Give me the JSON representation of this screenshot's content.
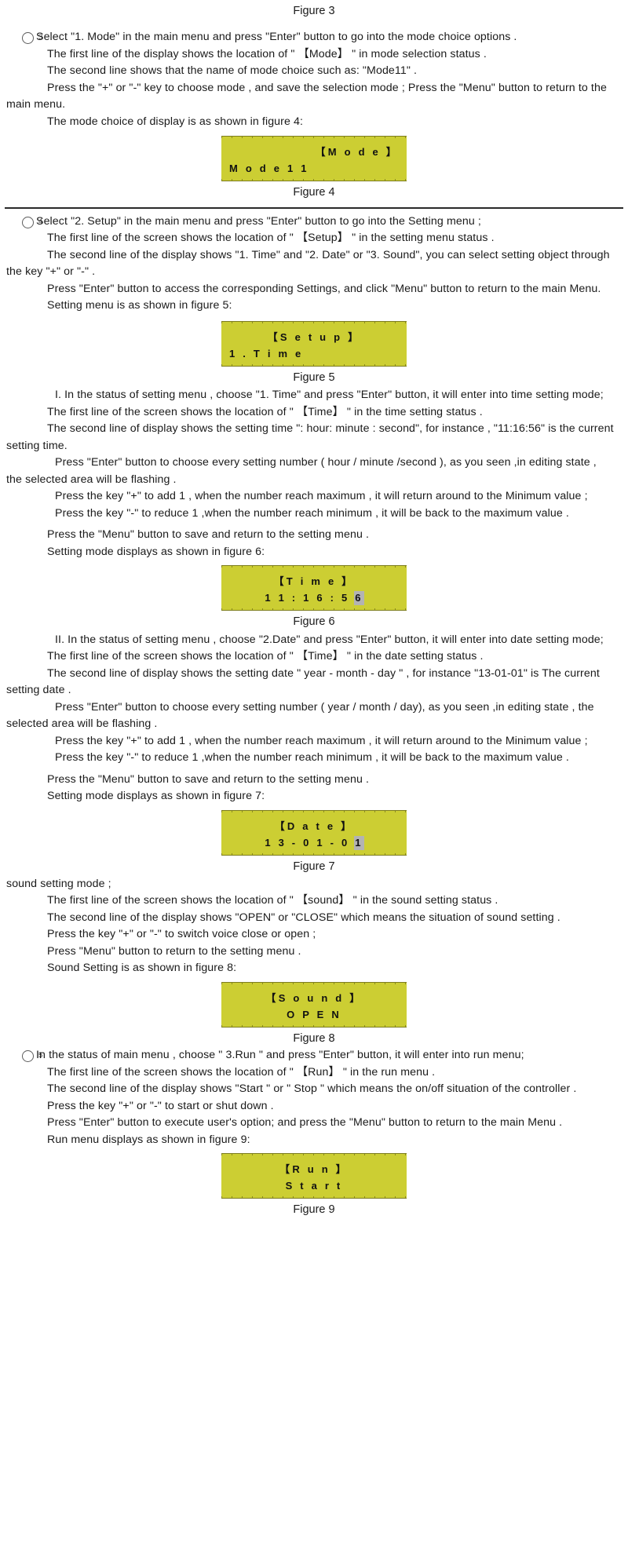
{
  "page": {
    "top_caption": "Figure 3"
  },
  "section3": {
    "marker": "3",
    "lines": [
      "Select \"1. Mode\" in the main menu and press \"Enter\" button to go into the mode choice options .",
      "The first line of the display shows the location of \" 【Mode】 \" in mode selection status .",
      "The second line shows that the name of mode choice such as: \"Mode11\" .",
      "Press the \"+\" or \"-\" key to choose mode , and save the selection mode ; Press the \"Menu\" button to return to the main menu.",
      "The mode choice of display is as shown in figure 4:"
    ]
  },
  "figure4": {
    "caption": "Figure 4",
    "line1": "【M o d e 】",
    "line2": "M o d e 1 1",
    "line1_align": "right",
    "line2_align": "left"
  },
  "section4": {
    "marker": "4",
    "lines": [
      "Select \"2. Setup\" in the main menu and press \"Enter\" button to go into the Setting menu ;",
      "The first line of the screen shows the location of \" 【Setup】 \" in the setting menu status .",
      "The second line of the display shows \"1. Time\" and \"2. Date\" or \"3. Sound\", you can select setting object through the key \"+\" or \"-\" .",
      "Press \"Enter\" button to access the corresponding Settings, and click \"Menu\" button to return to the main Menu.",
      "Setting menu is as shown in figure 5:"
    ]
  },
  "figure5": {
    "caption": "Figure 5",
    "line1": "【S e t u p 】",
    "line2": "1 . T i m e",
    "line1_align": "center",
    "line2_align": "left"
  },
  "sectionI": {
    "lines": [
      "I. In the status of setting menu , choose \"1. Time\" and press \"Enter\" button, it will enter into time setting mode;",
      "The first line of the screen shows the location of \" 【Time】 \" in the time setting status .",
      "The second line of display shows the setting time \": hour: minute : second\", for instance , \"11:16:56\" is the current setting time.",
      "Press \"Enter\" button to choose every setting number ( hour / minute /second ), as you seen ,in editing state , the selected area will be flashing .",
      "Press the key   \"+\" to add 1 , when the number reach maximum , it will return around to the Minimum value ;",
      "Press the key \"-\" to reduce 1 ,when the number reach minimum , it will be back to the maximum value .",
      "Press the \"Menu\" button to save and return to the setting menu .",
      "Setting mode displays as shown in figure 6:"
    ]
  },
  "figure6": {
    "caption": "Figure 6",
    "line1": "【T i m e 】",
    "line2_prefix": "1 1 : 1 6 : 5 ",
    "line2_highlight": "6",
    "line1_align": "center",
    "line2_align": "center",
    "highlight_color": "#b3b3b3"
  },
  "sectionII": {
    "lines": [
      "II. In the status of setting menu , choose \"2.Date\" and press \"Enter\" button, it will enter into date setting mode;",
      "The first line of the screen shows the location of \" 【Time】 \" in the date setting status .",
      "The second line of display shows the setting date \" year - month - day \" , for instance \"13-01-01\" is The current setting date .",
      "Press \"Enter\" button to choose every setting number ( year / month / day), as you seen ,in editing state , the selected area will be flashing .",
      "Press the key   \"+\" to add 1 , when the number reach maximum , it will return around to the Minimum value ;",
      "Press the key \"-\" to reduce 1 ,when the number reach minimum , it will be back to the maximum value .",
      "Press the \"Menu\" button to save and return to the setting menu .",
      "Setting mode displays as shown in figure 7:"
    ]
  },
  "figure7": {
    "caption": "Figure 7",
    "line1": "【D a t e 】",
    "line2_prefix": "1 3 - 0 1 - 0 ",
    "line2_highlight": "1",
    "line1_align": "center",
    "line2_align": "center",
    "highlight_color": "#b3b3b3"
  },
  "sectionIII": {
    "lines": [
      "sound setting mode ;",
      "The first line of the screen shows the location of \" 【sound】 \" in the sound setting status .",
      "The second line of the display shows \"OPEN\" or \"CLOSE\" which means the situation of sound setting .",
      "Press the key \"+\" or \"-\" to switch voice close or open ;",
      "Press \"Menu\" button to return to the setting menu .",
      "Sound Setting is as shown in figure 8:"
    ]
  },
  "figure8": {
    "caption": "Figure 8",
    "line1": "【S o u n d 】",
    "line2": "O P E N",
    "line1_align": "center",
    "line2_align": "center"
  },
  "section5": {
    "marker": "5",
    "lines": [
      "In the status of main menu , choose \" 3.Run \" and press \"Enter\" button, it will enter into run menu;",
      "The first line of the screen shows the location of \" 【Run】 \" in the run menu .",
      "The second line of the display shows \"Start \" or \" Stop \" which means the on/off situation of the controller .",
      "Press the key \"+\" or \"-\" to start or shut down .",
      "Press \"Enter\" button to execute user's option; and press the \"Menu\" button to return to the main Menu .",
      "Run menu displays as shown in figure 9:"
    ]
  },
  "figure9": {
    "caption": "Figure 9",
    "line1": "【R u n 】",
    "line2": "S t a r t",
    "line1_align": "center",
    "line2_align": "center"
  },
  "colors": {
    "lcd_background": "#ccce33",
    "lcd_border": "#7d7d1f",
    "highlight": "#b3b3b3",
    "text": "#1a1a1a"
  }
}
